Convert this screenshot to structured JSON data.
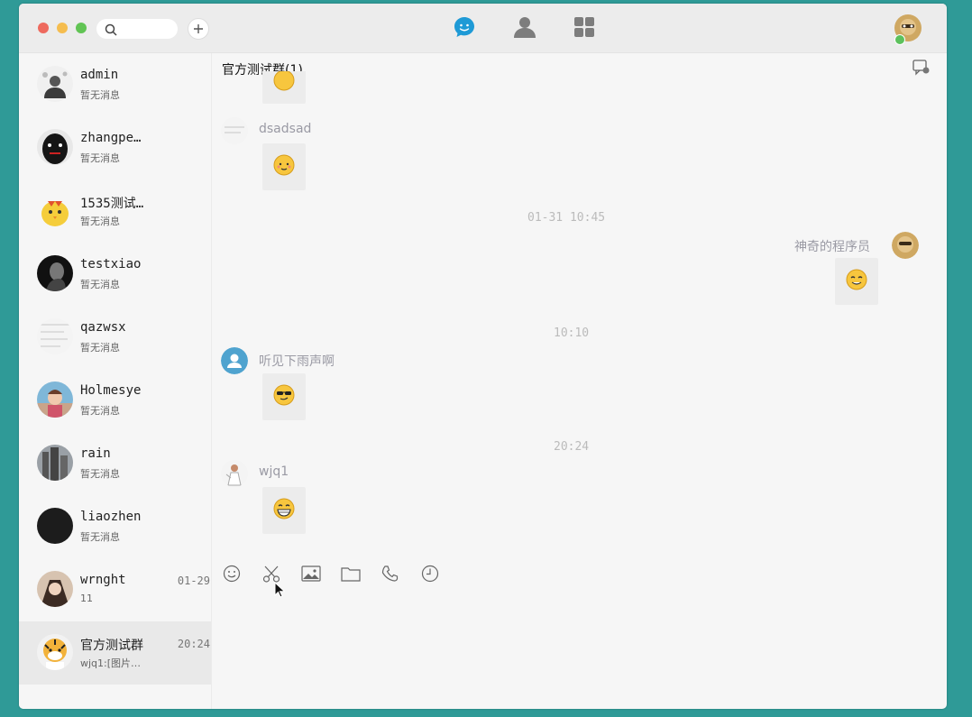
{
  "colors": {
    "accent": "#1e9ad6",
    "online": "#5dc15d",
    "background": "#2f9a97"
  },
  "search": {
    "placeholder": "",
    "value": ""
  },
  "conversations": [
    {
      "name": "admin",
      "preview": "暂无消息",
      "time": ""
    },
    {
      "name": "zhangpe…",
      "preview": "暂无消息",
      "time": ""
    },
    {
      "name": "1535测试…",
      "preview": "暂无消息",
      "time": ""
    },
    {
      "name": "testxiao",
      "preview": "暂无消息",
      "time": ""
    },
    {
      "name": "qazwsx",
      "preview": "暂无消息",
      "time": ""
    },
    {
      "name": "Holmesye",
      "preview": "暂无消息",
      "time": ""
    },
    {
      "name": "rain",
      "preview": "暂无消息",
      "time": ""
    },
    {
      "name": "liaozhen",
      "preview": "暂无消息",
      "time": ""
    },
    {
      "name": "wrnght",
      "preview": "11",
      "time": "01-29"
    },
    {
      "name": "官方测试群",
      "preview": "wjq1:[图片…",
      "time": "20:24"
    }
  ],
  "chat": {
    "title": "官方测试群(1)",
    "messages": [
      {
        "sender": "dsadsad",
        "emoji": "shy-emoji-icon"
      },
      {
        "timestamp": "01-31 10:45"
      },
      {
        "sender": "神奇的程序员",
        "emoji": "smile-emoji-icon"
      },
      {
        "timestamp": "10:10"
      },
      {
        "sender": "听见下雨声啊",
        "emoji": "sunglasses-emoji-icon"
      },
      {
        "timestamp": "20:24"
      },
      {
        "sender": "wjq1",
        "emoji": "grin-emoji-icon"
      }
    ]
  },
  "toolbar": {
    "icons": [
      "emoji-icon",
      "scissors-icon",
      "image-icon",
      "folder-icon",
      "phone-icon",
      "history-icon"
    ]
  }
}
